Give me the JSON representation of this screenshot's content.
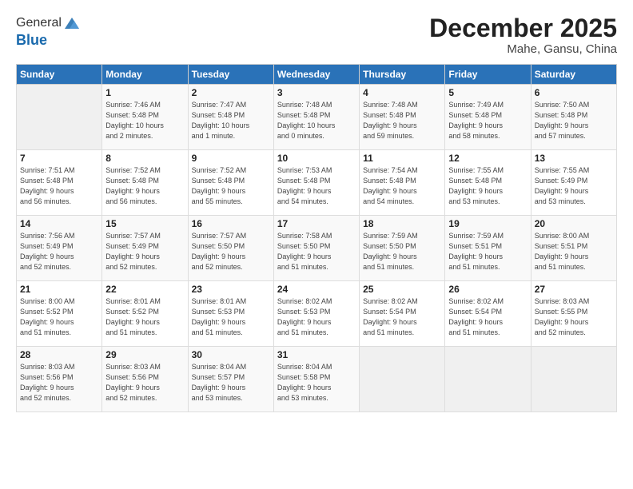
{
  "header": {
    "logo_line1": "General",
    "logo_line2": "Blue",
    "month": "December 2025",
    "location": "Mahe, Gansu, China"
  },
  "days_of_week": [
    "Sunday",
    "Monday",
    "Tuesday",
    "Wednesday",
    "Thursday",
    "Friday",
    "Saturday"
  ],
  "weeks": [
    [
      {
        "day": "",
        "info": ""
      },
      {
        "day": "1",
        "info": "Sunrise: 7:46 AM\nSunset: 5:48 PM\nDaylight: 10 hours\nand 2 minutes."
      },
      {
        "day": "2",
        "info": "Sunrise: 7:47 AM\nSunset: 5:48 PM\nDaylight: 10 hours\nand 1 minute."
      },
      {
        "day": "3",
        "info": "Sunrise: 7:48 AM\nSunset: 5:48 PM\nDaylight: 10 hours\nand 0 minutes."
      },
      {
        "day": "4",
        "info": "Sunrise: 7:48 AM\nSunset: 5:48 PM\nDaylight: 9 hours\nand 59 minutes."
      },
      {
        "day": "5",
        "info": "Sunrise: 7:49 AM\nSunset: 5:48 PM\nDaylight: 9 hours\nand 58 minutes."
      },
      {
        "day": "6",
        "info": "Sunrise: 7:50 AM\nSunset: 5:48 PM\nDaylight: 9 hours\nand 57 minutes."
      }
    ],
    [
      {
        "day": "7",
        "info": "Sunrise: 7:51 AM\nSunset: 5:48 PM\nDaylight: 9 hours\nand 56 minutes."
      },
      {
        "day": "8",
        "info": "Sunrise: 7:52 AM\nSunset: 5:48 PM\nDaylight: 9 hours\nand 56 minutes."
      },
      {
        "day": "9",
        "info": "Sunrise: 7:52 AM\nSunset: 5:48 PM\nDaylight: 9 hours\nand 55 minutes."
      },
      {
        "day": "10",
        "info": "Sunrise: 7:53 AM\nSunset: 5:48 PM\nDaylight: 9 hours\nand 54 minutes."
      },
      {
        "day": "11",
        "info": "Sunrise: 7:54 AM\nSunset: 5:48 PM\nDaylight: 9 hours\nand 54 minutes."
      },
      {
        "day": "12",
        "info": "Sunrise: 7:55 AM\nSunset: 5:48 PM\nDaylight: 9 hours\nand 53 minutes."
      },
      {
        "day": "13",
        "info": "Sunrise: 7:55 AM\nSunset: 5:49 PM\nDaylight: 9 hours\nand 53 minutes."
      }
    ],
    [
      {
        "day": "14",
        "info": "Sunrise: 7:56 AM\nSunset: 5:49 PM\nDaylight: 9 hours\nand 52 minutes."
      },
      {
        "day": "15",
        "info": "Sunrise: 7:57 AM\nSunset: 5:49 PM\nDaylight: 9 hours\nand 52 minutes."
      },
      {
        "day": "16",
        "info": "Sunrise: 7:57 AM\nSunset: 5:50 PM\nDaylight: 9 hours\nand 52 minutes."
      },
      {
        "day": "17",
        "info": "Sunrise: 7:58 AM\nSunset: 5:50 PM\nDaylight: 9 hours\nand 51 minutes."
      },
      {
        "day": "18",
        "info": "Sunrise: 7:59 AM\nSunset: 5:50 PM\nDaylight: 9 hours\nand 51 minutes."
      },
      {
        "day": "19",
        "info": "Sunrise: 7:59 AM\nSunset: 5:51 PM\nDaylight: 9 hours\nand 51 minutes."
      },
      {
        "day": "20",
        "info": "Sunrise: 8:00 AM\nSunset: 5:51 PM\nDaylight: 9 hours\nand 51 minutes."
      }
    ],
    [
      {
        "day": "21",
        "info": "Sunrise: 8:00 AM\nSunset: 5:52 PM\nDaylight: 9 hours\nand 51 minutes."
      },
      {
        "day": "22",
        "info": "Sunrise: 8:01 AM\nSunset: 5:52 PM\nDaylight: 9 hours\nand 51 minutes."
      },
      {
        "day": "23",
        "info": "Sunrise: 8:01 AM\nSunset: 5:53 PM\nDaylight: 9 hours\nand 51 minutes."
      },
      {
        "day": "24",
        "info": "Sunrise: 8:02 AM\nSunset: 5:53 PM\nDaylight: 9 hours\nand 51 minutes."
      },
      {
        "day": "25",
        "info": "Sunrise: 8:02 AM\nSunset: 5:54 PM\nDaylight: 9 hours\nand 51 minutes."
      },
      {
        "day": "26",
        "info": "Sunrise: 8:02 AM\nSunset: 5:54 PM\nDaylight: 9 hours\nand 51 minutes."
      },
      {
        "day": "27",
        "info": "Sunrise: 8:03 AM\nSunset: 5:55 PM\nDaylight: 9 hours\nand 52 minutes."
      }
    ],
    [
      {
        "day": "28",
        "info": "Sunrise: 8:03 AM\nSunset: 5:56 PM\nDaylight: 9 hours\nand 52 minutes."
      },
      {
        "day": "29",
        "info": "Sunrise: 8:03 AM\nSunset: 5:56 PM\nDaylight: 9 hours\nand 52 minutes."
      },
      {
        "day": "30",
        "info": "Sunrise: 8:04 AM\nSunset: 5:57 PM\nDaylight: 9 hours\nand 53 minutes."
      },
      {
        "day": "31",
        "info": "Sunrise: 8:04 AM\nSunset: 5:58 PM\nDaylight: 9 hours\nand 53 minutes."
      },
      {
        "day": "",
        "info": ""
      },
      {
        "day": "",
        "info": ""
      },
      {
        "day": "",
        "info": ""
      }
    ]
  ]
}
